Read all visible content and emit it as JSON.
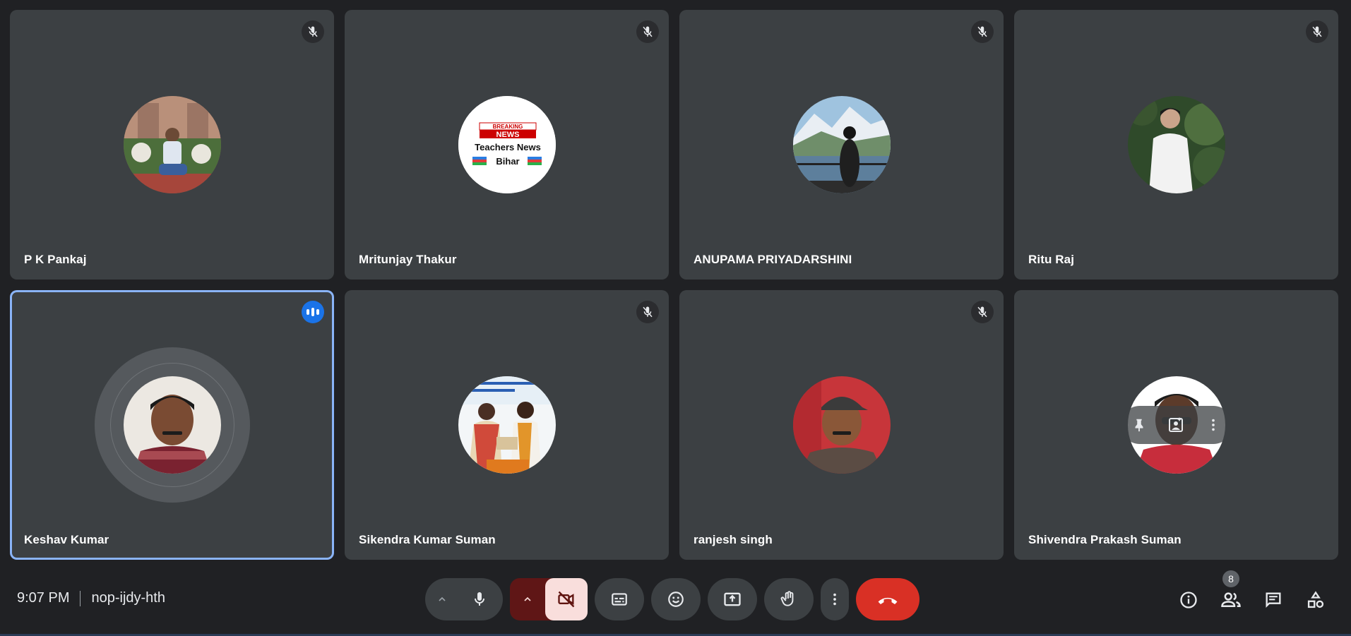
{
  "participants": [
    {
      "name": "P K Pankaj",
      "status": "muted",
      "avatar": "photo-man-garden"
    },
    {
      "name": "Mritunjay Thakur",
      "status": "muted",
      "avatar": "logo-breaking-news",
      "logo": {
        "line1": "BREAKING",
        "line2": "NEWS",
        "line3": "Teachers News",
        "line4": "Bihar"
      }
    },
    {
      "name": "ANUPAMA PRIYADARSHINI",
      "status": "muted",
      "avatar": "photo-woman-mountains"
    },
    {
      "name": "Ritu Raj",
      "status": "muted",
      "avatar": "photo-man-white-shirt"
    },
    {
      "name": "Keshav Kumar",
      "status": "speaking",
      "avatar": "photo-man-checked-shirt"
    },
    {
      "name": "Sikendra Kumar Suman",
      "status": "muted",
      "avatar": "photo-award-ceremony"
    },
    {
      "name": "ranjesh singh",
      "status": "muted",
      "avatar": "photo-man-cap"
    },
    {
      "name": "Shivendra Prakash Suman",
      "status": "hover",
      "avatar": "photo-man-red-shirt"
    }
  ],
  "meeting": {
    "time": "9:07 PM",
    "code": "nop-ijdy-hth"
  },
  "people_count": "8",
  "colors": {
    "tile": "#3c4043",
    "background": "#202124",
    "speaking_border": "#8ab4f8",
    "leave": "#d93025",
    "camera_off": "#f9dedc"
  },
  "icons": {
    "controls": [
      "chevron-up-icon",
      "microphone-icon",
      "chevron-up-icon",
      "camera-off-icon",
      "captions-icon",
      "emoji-icon",
      "present-icon",
      "raise-hand-icon",
      "more-vert-icon",
      "end-call-icon"
    ],
    "right": [
      "info-icon",
      "people-icon",
      "chat-icon",
      "activities-icon"
    ]
  }
}
